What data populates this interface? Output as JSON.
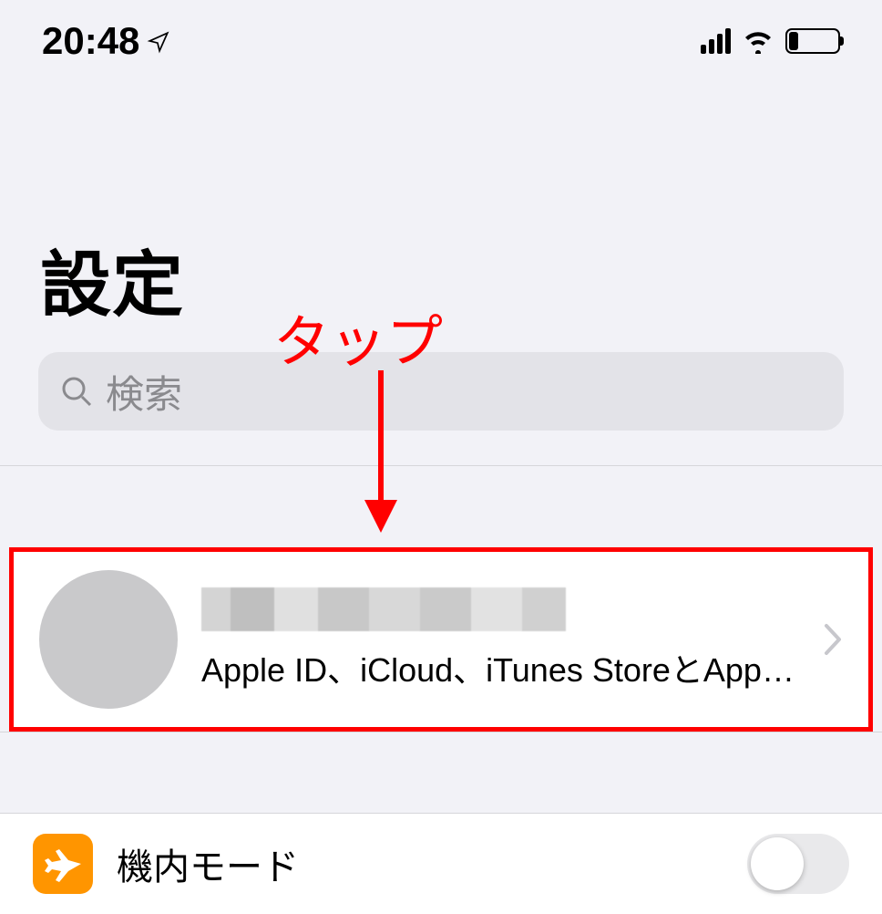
{
  "status": {
    "time": "20:48"
  },
  "header": {
    "title": "設定"
  },
  "search": {
    "placeholder": "検索"
  },
  "annotation": {
    "label": "タップ"
  },
  "apple_id": {
    "subtitle": "Apple ID、iCloud、iTunes StoreとApp S..."
  },
  "rows": {
    "airplane": {
      "label": "機内モード",
      "toggle_on": false
    }
  }
}
